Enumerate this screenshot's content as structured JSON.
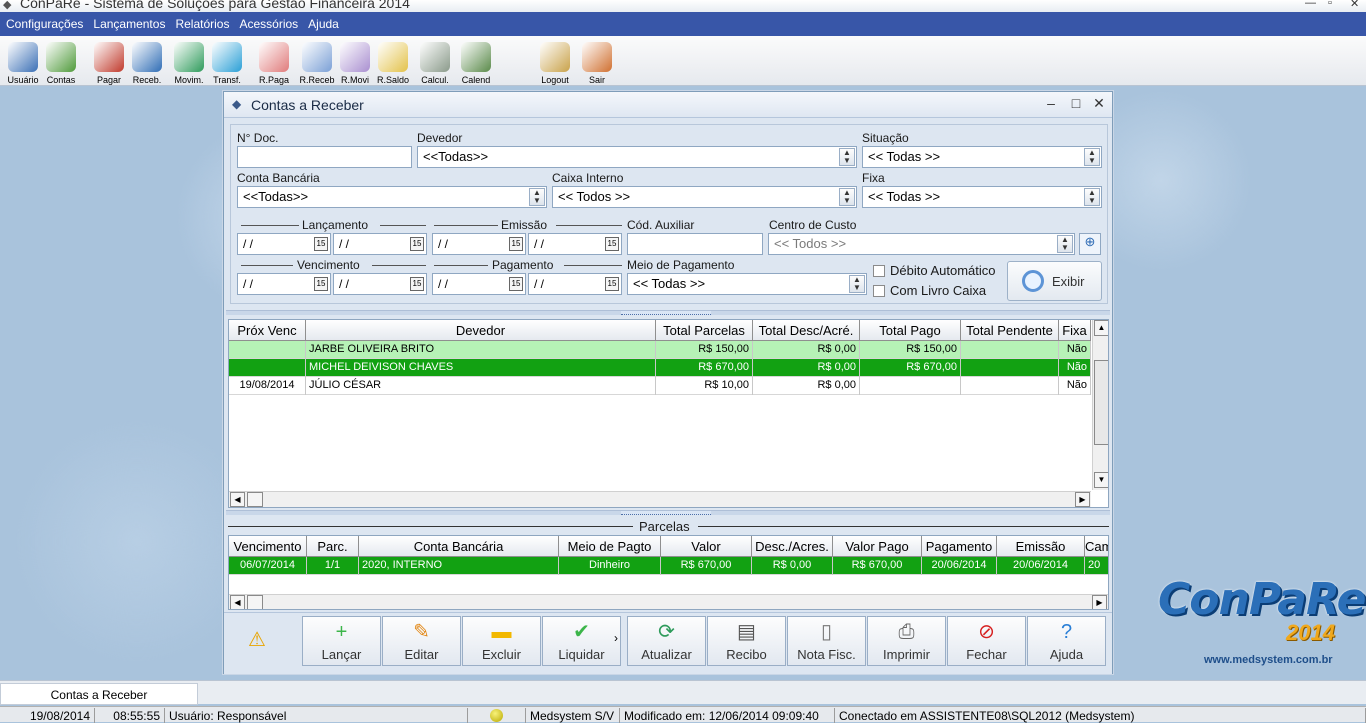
{
  "app": {
    "title": "ConPaRe - Sistema de Soluções para Gestão Financeira 2014"
  },
  "menu": [
    "Configurações",
    "Lançamentos",
    "Relatórios",
    "Acessórios",
    "Ajuda"
  ],
  "toolbar": [
    {
      "name": "usuario",
      "label": "Usuário",
      "color": "#3a6fb5"
    },
    {
      "name": "contas",
      "label": "Contas",
      "color": "#4f9a3a"
    },
    {
      "name": "pagar",
      "label": "Pagar",
      "color": "#c0392b"
    },
    {
      "name": "receb",
      "label": "Receb.",
      "color": "#2f6db5"
    },
    {
      "name": "movim",
      "label": "Movim.",
      "color": "#2e9b5b"
    },
    {
      "name": "transf",
      "label": "Transf.",
      "color": "#2a9fd6"
    },
    {
      "name": "rpaga",
      "label": "R.Paga",
      "color": "#e07b7b"
    },
    {
      "name": "rreceb",
      "label": "R.Receb",
      "color": "#7ba0d6"
    },
    {
      "name": "rmovi",
      "label": "R.Movi",
      "color": "#a98fd0"
    },
    {
      "name": "rsaldo",
      "label": "R.Saldo",
      "color": "#e3c24a"
    },
    {
      "name": "calcul",
      "label": "Calcul.",
      "color": "#8a9a8a"
    },
    {
      "name": "calend",
      "label": "Calend",
      "color": "#5a8a4a"
    },
    {
      "name": "logout",
      "label": "Logout",
      "color": "#c9a24a"
    },
    {
      "name": "sair",
      "label": "Sair",
      "color": "#d07030"
    }
  ],
  "window": {
    "title": "Contas a Receber"
  },
  "filters": {
    "ndoc_label": "N° Doc.",
    "ndoc_value": "",
    "devedor_label": "Devedor",
    "devedor_value": "<<Todas>>",
    "situacao_label": "Situação",
    "situacao_value": "<< Todas >>",
    "conta_label": "Conta Bancária",
    "conta_value": "<<Todas>>",
    "caixa_label": "Caixa Interno",
    "caixa_value": "<< Todos >>",
    "fixa_label": "Fixa",
    "fixa_value": "<< Todas >>",
    "lancamento_label": "Lançamento",
    "emissao_label": "Emissão",
    "codaux_label": "Cód. Auxiliar",
    "centro_label": "Centro de Custo",
    "centro_value": "<< Todos >>",
    "vencimento_label": "Vencimento",
    "pagamento_label": "Pagamento",
    "meio_label": "Meio de Pagamento",
    "meio_value": "<< Todas >>",
    "debito_label": "Débito Automático",
    "livro_label": "Com Livro Caixa",
    "date_empty": "/ /",
    "exibir_label": "Exibir"
  },
  "main_grid": {
    "columns": [
      "Próx Venc",
      "Devedor",
      "Total Parcelas",
      "Total Desc/Acré.",
      "Total Pago",
      "Total Pendente",
      "Fixa"
    ],
    "rows": [
      {
        "venc": "",
        "devedor": "JARBE OLIVEIRA BRITO",
        "parcelas": "R$ 150,00",
        "desc": "R$ 0,00",
        "pago": "R$ 150,00",
        "pendente": "",
        "fixa": "Não",
        "style": "light"
      },
      {
        "venc": "",
        "devedor": "MICHEL DEIVISON CHAVES",
        "parcelas": "R$ 670,00",
        "desc": "R$ 0,00",
        "pago": "R$ 670,00",
        "pendente": "",
        "fixa": "Não",
        "style": "dark"
      },
      {
        "venc": "19/08/2014",
        "devedor": "JÚLIO CÉSAR",
        "parcelas": "R$ 10,00",
        "desc": "R$ 0,00",
        "pago": "",
        "pendente": "",
        "fixa": "Não",
        "style": "white"
      }
    ]
  },
  "parcelas": {
    "title": "Parcelas",
    "columns": [
      "Vencimento",
      "Parc.",
      "Conta Bancária",
      "Meio de Pagto",
      "Valor",
      "Desc./Acres.",
      "Valor Pago",
      "Pagamento",
      "Emissão",
      "Cam"
    ],
    "rows": [
      {
        "venc": "06/07/2014",
        "parc": "1/1",
        "conta": "2020, INTERNO",
        "meio": "Dinheiro",
        "valor": "R$ 670,00",
        "desc": "R$ 0,00",
        "pago": "R$ 670,00",
        "pagamento": "20/06/2014",
        "emissao": "20/06/2014",
        "cam": "20"
      }
    ]
  },
  "actions": [
    {
      "name": "lancar",
      "label": "Lançar",
      "icon": "+",
      "color": "#3cb54a"
    },
    {
      "name": "editar",
      "label": "Editar",
      "icon": "✎",
      "color": "#e38a1a"
    },
    {
      "name": "excluir",
      "label": "Excluir",
      "icon": "▬",
      "color": "#f2b800"
    },
    {
      "name": "liquidar",
      "label": "Liquidar",
      "icon": "✔",
      "color": "#3cb54a"
    },
    {
      "name": "atualizar",
      "label": "Atualizar",
      "icon": "⟳",
      "color": "#2e9b5b"
    },
    {
      "name": "recibo",
      "label": "Recibo",
      "icon": "▤",
      "color": "#555555"
    },
    {
      "name": "notafisc",
      "label": "Nota Fisc.",
      "icon": "▯",
      "color": "#777777"
    },
    {
      "name": "imprimir",
      "label": "Imprimir",
      "icon": "⎙",
      "color": "#666666"
    },
    {
      "name": "fechar",
      "label": "Fechar",
      "icon": "⊘",
      "color": "#d62020"
    },
    {
      "name": "ajuda",
      "label": "Ajuda",
      "icon": "?",
      "color": "#2a7fd6"
    }
  ],
  "logo": {
    "name": "ConPaRe",
    "year": "2014",
    "url": "www.medsystem.com.br"
  },
  "tabbar": {
    "tab": "Contas a Receber"
  },
  "status": {
    "date": "19/08/2014",
    "time": "08:55:55",
    "user": "Usuário: Responsável",
    "company": "Medsystem S/V",
    "modified": "Modificado em: 12/06/2014 09:09:40",
    "connected": "Conectado em ASSISTENTE08\\SQL2012 (Medsystem)"
  }
}
